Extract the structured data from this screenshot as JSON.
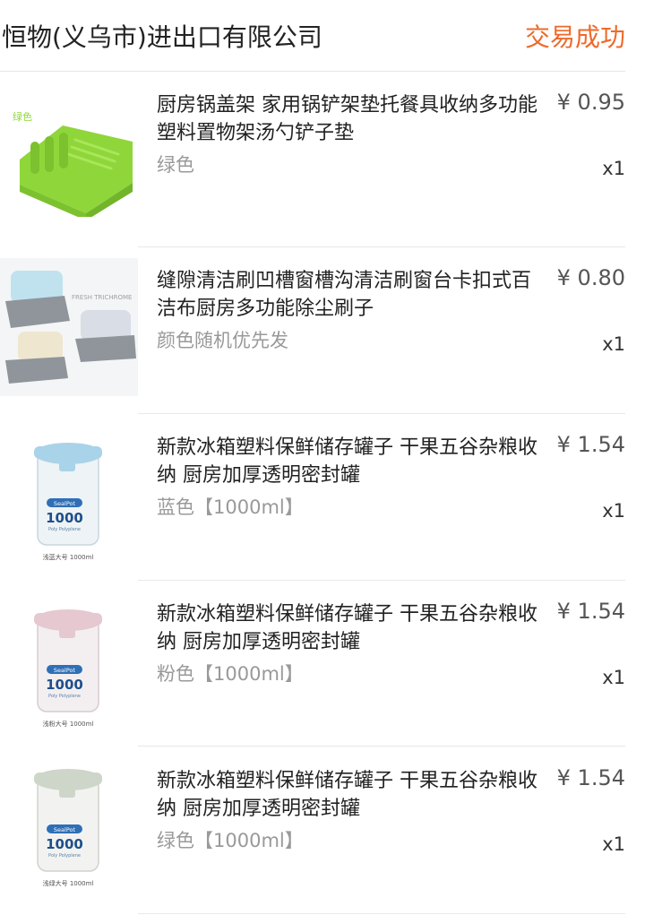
{
  "header": {
    "shop_name": "恒物(义乌市)进出口有限公司",
    "status": "交易成功"
  },
  "items": [
    {
      "title": "厨房锅盖架 家用锅铲架垫托餐具收纳多功能塑料置物架汤勺铲子垫",
      "sku": "绿色",
      "price": "¥ 0.95",
      "qty": "x1",
      "image_label": "绿色",
      "image_color": "#8fd63a"
    },
    {
      "title": "缝隙清洁刷凹槽窗槽沟清洁刷窗台卡扣式百洁布厨房多功能除尘刷子",
      "sku": "颜色随机优先发",
      "price": "¥ 0.80",
      "qty": "x1",
      "image_label": "FRESH TRICHROME",
      "image_color": "#bfe2ee"
    },
    {
      "title": "新款冰箱塑料保鲜储存罐子 干果五谷杂粮收纳 厨房加厚透明密封罐",
      "sku": "蓝色【1000ml】",
      "price": "¥ 1.54",
      "qty": "x1",
      "image_label": "浅蓝大号 1000ml",
      "image_color": "#a9d3e8",
      "jar_brand": "SealPot",
      "jar_volume": "1000",
      "jar_material": "Poly Polyplene"
    },
    {
      "title": "新款冰箱塑料保鲜储存罐子 干果五谷杂粮收纳 厨房加厚透明密封罐",
      "sku": "粉色【1000ml】",
      "price": "¥ 1.54",
      "qty": "x1",
      "image_label": "浅粉大号 1000ml",
      "image_color": "#e6c8d0",
      "jar_brand": "SealPot",
      "jar_volume": "1000",
      "jar_material": "Poly Polyplene"
    },
    {
      "title": "新款冰箱塑料保鲜储存罐子 干果五谷杂粮收纳 厨房加厚透明密封罐",
      "sku": "绿色【1000ml】",
      "price": "¥ 1.54",
      "qty": "x1",
      "image_label": "浅绿大号 1000ml",
      "image_color": "#cdd6c8",
      "jar_brand": "SealPot",
      "jar_volume": "1000",
      "jar_material": "Poly Polyplene"
    }
  ]
}
